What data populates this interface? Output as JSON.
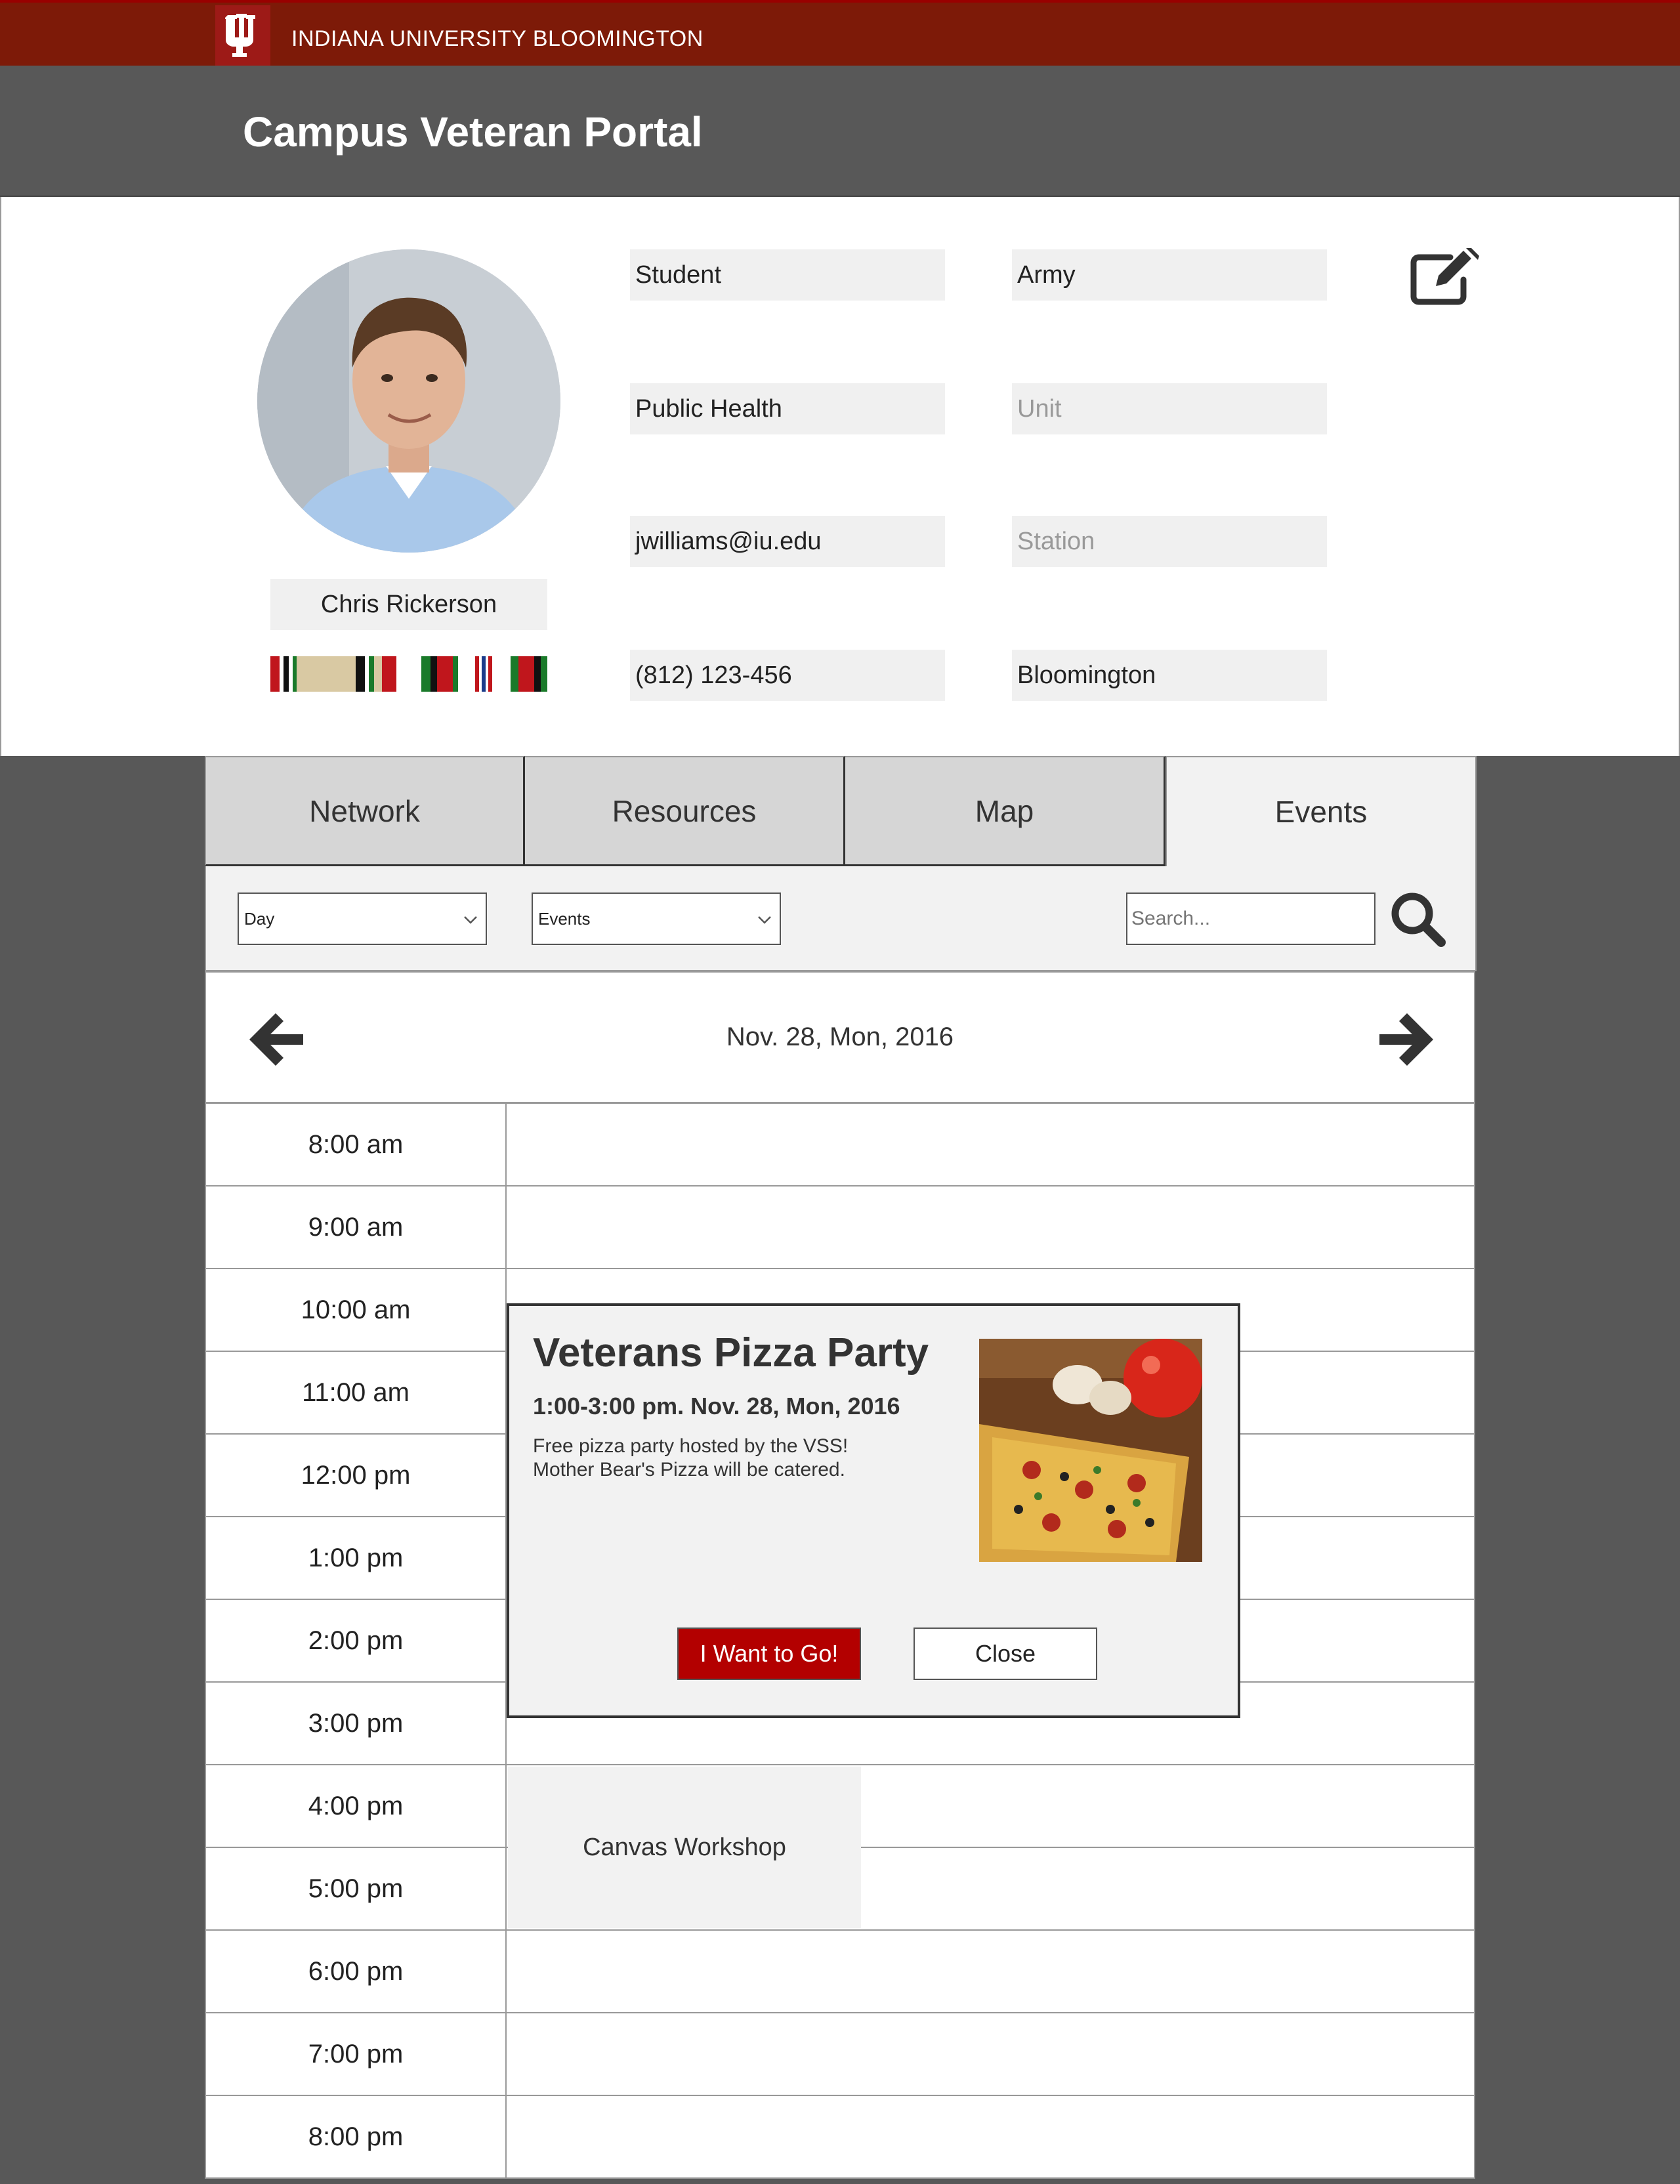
{
  "header": {
    "university": "INDIANA UNIVERSITY BLOOMINGTON",
    "portal_title": "Campus Veteran Portal",
    "logo_icon": "iu-trident-logo",
    "brand_color": "#7d1a08"
  },
  "profile": {
    "name": "Chris Rickerson",
    "fields": {
      "role": "Student",
      "branch": "Army",
      "department": "Public Health",
      "unit_placeholder": "Unit",
      "email": "jwilliams@iu.edu",
      "station_placeholder": "Station",
      "phone": "(812) 123-456",
      "city": "Bloomington"
    },
    "edit_icon": "edit-icon"
  },
  "tabs": [
    {
      "label": "Network"
    },
    {
      "label": "Resources"
    },
    {
      "label": "Map"
    },
    {
      "label": "Events",
      "active": true
    }
  ],
  "filters": {
    "view_select": "Day",
    "type_select": "Events",
    "search_placeholder": "Search..."
  },
  "calendar": {
    "date": "Nov. 28, Mon, 2016",
    "times": [
      "8:00 am",
      "9:00 am",
      "10:00 am",
      "11:00 am",
      "12:00 pm",
      "1:00 pm",
      "2:00 pm",
      "3:00 pm",
      "4:00 pm",
      "5:00 pm",
      "6:00 pm",
      "7:00 pm",
      "8:00 pm"
    ],
    "events": [
      {
        "title": "Canvas Workshop"
      }
    ]
  },
  "modal": {
    "title": "Veterans Pizza Party",
    "time": "1:00-3:00 pm. Nov. 28, Mon, 2016",
    "description_line1": "Free pizza party hosted by the VSS!",
    "description_line2": "Mother Bear's Pizza will be catered.",
    "go_label": "I Want to Go!",
    "close_label": "Close",
    "go_color": "#b30000"
  }
}
